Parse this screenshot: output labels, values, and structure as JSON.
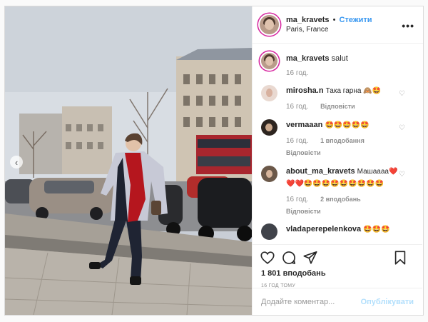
{
  "post": {
    "author": "ma_kravets",
    "follow_label": "Стежити",
    "location": "Paris, France",
    "more_label": "•••"
  },
  "comments": [
    {
      "user": "ma_kravets",
      "text": "salut",
      "time": "16 год.",
      "reply": "",
      "likes": ""
    },
    {
      "user": "mirosha.n",
      "text": "Така гарна 🙈🤩",
      "time": "16 год.",
      "reply": "Відповісти",
      "likes": ""
    },
    {
      "user": "vermaaan",
      "text": "🤩🤩🤩🤩🤩",
      "time": "16 год.",
      "reply": "Відповісти",
      "likes": "1 вподобання"
    },
    {
      "user": "about_ma_kravets",
      "text": "Машаааа❤️❤️❤️🤩🤩🤩🤩🤩🤩🤩🤩🤩",
      "time": "16 год.",
      "reply": "Відповісти",
      "likes": "2 вподобань"
    },
    {
      "user": "vladaperepelenkova",
      "text": "🤩🤩🤩",
      "time": "",
      "reply": "",
      "likes": ""
    }
  ],
  "stats": {
    "likes": "1 801 вподобань",
    "time_ago": "16 ГОД ТОМУ"
  },
  "composer": {
    "placeholder": "Додайте коментар...",
    "publish_label": "Опублікувати"
  },
  "icons": [
    "heart-icon",
    "comment-icon",
    "share-icon",
    "bookmark-icon",
    "chevron-left-icon",
    "more-icon"
  ]
}
